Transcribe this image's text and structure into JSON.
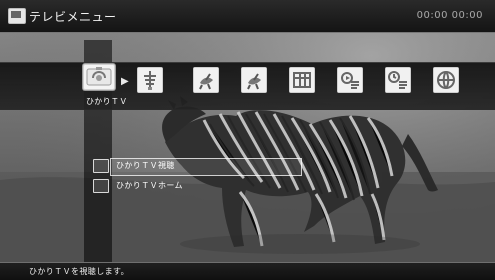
{
  "window": {
    "title": "テレビメニュー",
    "clock": "00:00 00:00"
  },
  "selected_category": {
    "label": "ひかりＴＶ"
  },
  "menu": {
    "items": [
      {
        "label": "ひかりＴＶ視聴",
        "selected": true,
        "icon": "tv-icon"
      },
      {
        "label": "ひかりＴＶホーム",
        "selected": false,
        "icon": "home-icon"
      }
    ]
  },
  "icons": [
    {
      "name": "hikari-tv-icon"
    },
    {
      "name": "antenna-icon"
    },
    {
      "name": "satellite-dish-icon"
    },
    {
      "name": "satellite-dish-2-icon"
    },
    {
      "name": "program-guide-icon"
    },
    {
      "name": "recorded-video-icon"
    },
    {
      "name": "reservation-icon"
    },
    {
      "name": "globe-icon"
    }
  ],
  "status": {
    "text": "ひかりＴＶを視聴します。"
  }
}
